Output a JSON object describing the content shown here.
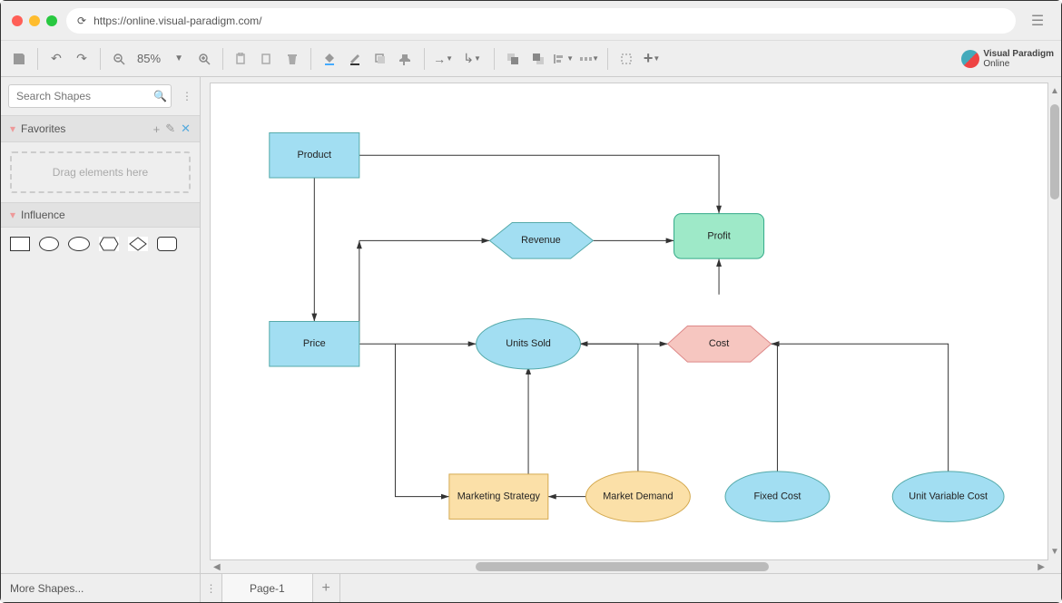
{
  "browser": {
    "url": "https://online.visual-paradigm.com/"
  },
  "toolbar": {
    "zoom": "85%"
  },
  "logo": {
    "line1": "Visual Paradigm",
    "line2": "Online"
  },
  "sidebar": {
    "search_placeholder": "Search Shapes",
    "favorites_label": "Favorites",
    "drag_hint": "Drag elements here",
    "influence_label": "Influence"
  },
  "footer": {
    "more_shapes": "More Shapes...",
    "page1": "Page-1"
  },
  "diagram": {
    "nodes": {
      "product": "Product",
      "price": "Price",
      "revenue": "Revenue",
      "profit": "Profit",
      "units_sold": "Units Sold",
      "cost": "Cost",
      "marketing_strategy": "Marketing Strategy",
      "market_demand": "Market Demand",
      "fixed_cost": "Fixed Cost",
      "unit_variable_cost": "Unit Variable Cost"
    }
  }
}
